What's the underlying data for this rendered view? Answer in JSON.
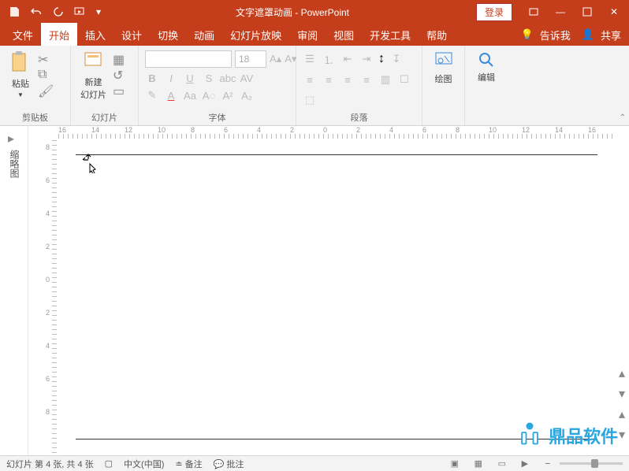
{
  "title": "文字遮罩动画 - PowerPoint",
  "login": "登录",
  "tabs": {
    "file": "文件",
    "home": "开始",
    "insert": "插入",
    "design": "设计",
    "transitions": "切换",
    "animations": "动画",
    "slideshow": "幻灯片放映",
    "review": "审阅",
    "view": "视图",
    "developer": "开发工具",
    "help": "帮助",
    "tellme": "告诉我",
    "share": "共享"
  },
  "groups": {
    "clipboard": "剪贴板",
    "slides": "幻灯片",
    "font": "字体",
    "paragraph": "段落",
    "drawing": "绘图",
    "editing": "编辑"
  },
  "buttons": {
    "paste": "粘贴",
    "newslide": "新建\n幻灯片",
    "draw": "绘图",
    "edit": "编辑"
  },
  "font": {
    "name": "",
    "size": "18"
  },
  "outline": "缩略图",
  "status": {
    "slide": "幻灯片 第 4 张, 共 4 张",
    "lang": "中文(中国)",
    "notes": "备注",
    "comments": "批注"
  },
  "ruler_h": [
    "16",
    "14",
    "12",
    "10",
    "8",
    "6",
    "4",
    "2",
    "0",
    "2",
    "4",
    "6",
    "8",
    "10",
    "12",
    "14",
    "16"
  ],
  "ruler_v": [
    "8",
    "6",
    "4",
    "2",
    "0",
    "2",
    "4",
    "6",
    "8"
  ],
  "watermark": "鼎品软件"
}
